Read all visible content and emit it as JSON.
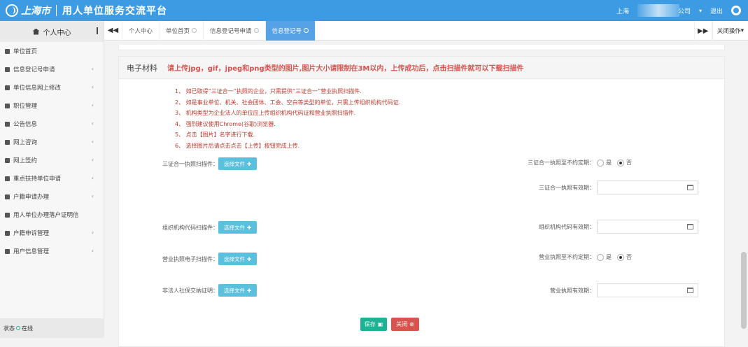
{
  "header": {
    "logo_city": "上海市",
    "app_title": "用人单位服务交流平台",
    "location": "上海",
    "company_suffix": "公司",
    "logout": "退出"
  },
  "sidebar": {
    "title": "个人中心",
    "items": [
      {
        "label": "单位首页",
        "icon": "bookmark-icon"
      },
      {
        "label": "信息登记号申请",
        "icon": "copy-icon",
        "arrow": "‹"
      },
      {
        "label": "单位信息网上修改",
        "icon": "adjust-icon",
        "arrow": "‹"
      },
      {
        "label": "职位管理",
        "icon": "list-icon",
        "arrow": "‹"
      },
      {
        "label": "公告信息",
        "icon": "check-icon",
        "arrow": "‹"
      },
      {
        "label": "网上咨询",
        "icon": "help-icon",
        "arrow": "‹"
      },
      {
        "label": "网上签约",
        "icon": "eye-icon",
        "arrow": "‹"
      },
      {
        "label": "重点扶持单位申请",
        "icon": "pencil-icon",
        "arrow": "‹"
      },
      {
        "label": "户籍申请办理",
        "icon": "download-icon",
        "arrow": "‹"
      },
      {
        "label": "用人单位办理落户证明信",
        "icon": "envelope-icon"
      },
      {
        "label": "户籍申诉管理",
        "icon": "adjust-icon",
        "arrow": "‹"
      },
      {
        "label": "用户信息管理",
        "icon": "bell-icon",
        "arrow": "‹"
      }
    ],
    "status": "状态",
    "status_value": "在线"
  },
  "tabs": {
    "items": [
      "个人中心",
      "单位首页",
      "信息登记号申请",
      "信息登记号"
    ],
    "close_ops": "关闭操作"
  },
  "panel": {
    "title": "电子材料",
    "warning": "请上传jpg，gif，jpeg和png类型的图片,图片大小请限制在3M以内，上传成功后，点击扫描件就可以下载扫描件",
    "notes": [
      "1、 如已取得“三证合一”执照的企业，只需提供“三证合一”营业执照扫描件.",
      "2、 如是事业单位、机关、社会团体、工会、空白等类型的单位，只需上传组织机构代码证.",
      "3、 机构类型为企业法人的单位应上传组织机构代码证和营业执照扫描件.",
      "4、 强烈建议使用Chrome(谷歌)浏览器.",
      "5、 点击【图片】名字进行下载.",
      "6、 选择图片后请点击点击【上传】按钮完成上传."
    ],
    "file_button": "选择文件",
    "labels": {
      "scan_3in1": "三证合一执照扫描件：",
      "scan_org": "组织机构代码扫描件：",
      "scan_biz": "营业执照电子扫描件：",
      "nonlegal_proof": "非法人社保交纳证明：",
      "perm_3in1": "三证合一执照至不约定期：",
      "valid_3in1": "三证合一执照有效期：",
      "valid_org": "组织机构代码有效期：",
      "perm_biz": "营业执照至不约定期：",
      "valid_biz": "营业执照有效期："
    },
    "yes": "是",
    "no": "否",
    "save": "保存",
    "close": "关闭"
  }
}
